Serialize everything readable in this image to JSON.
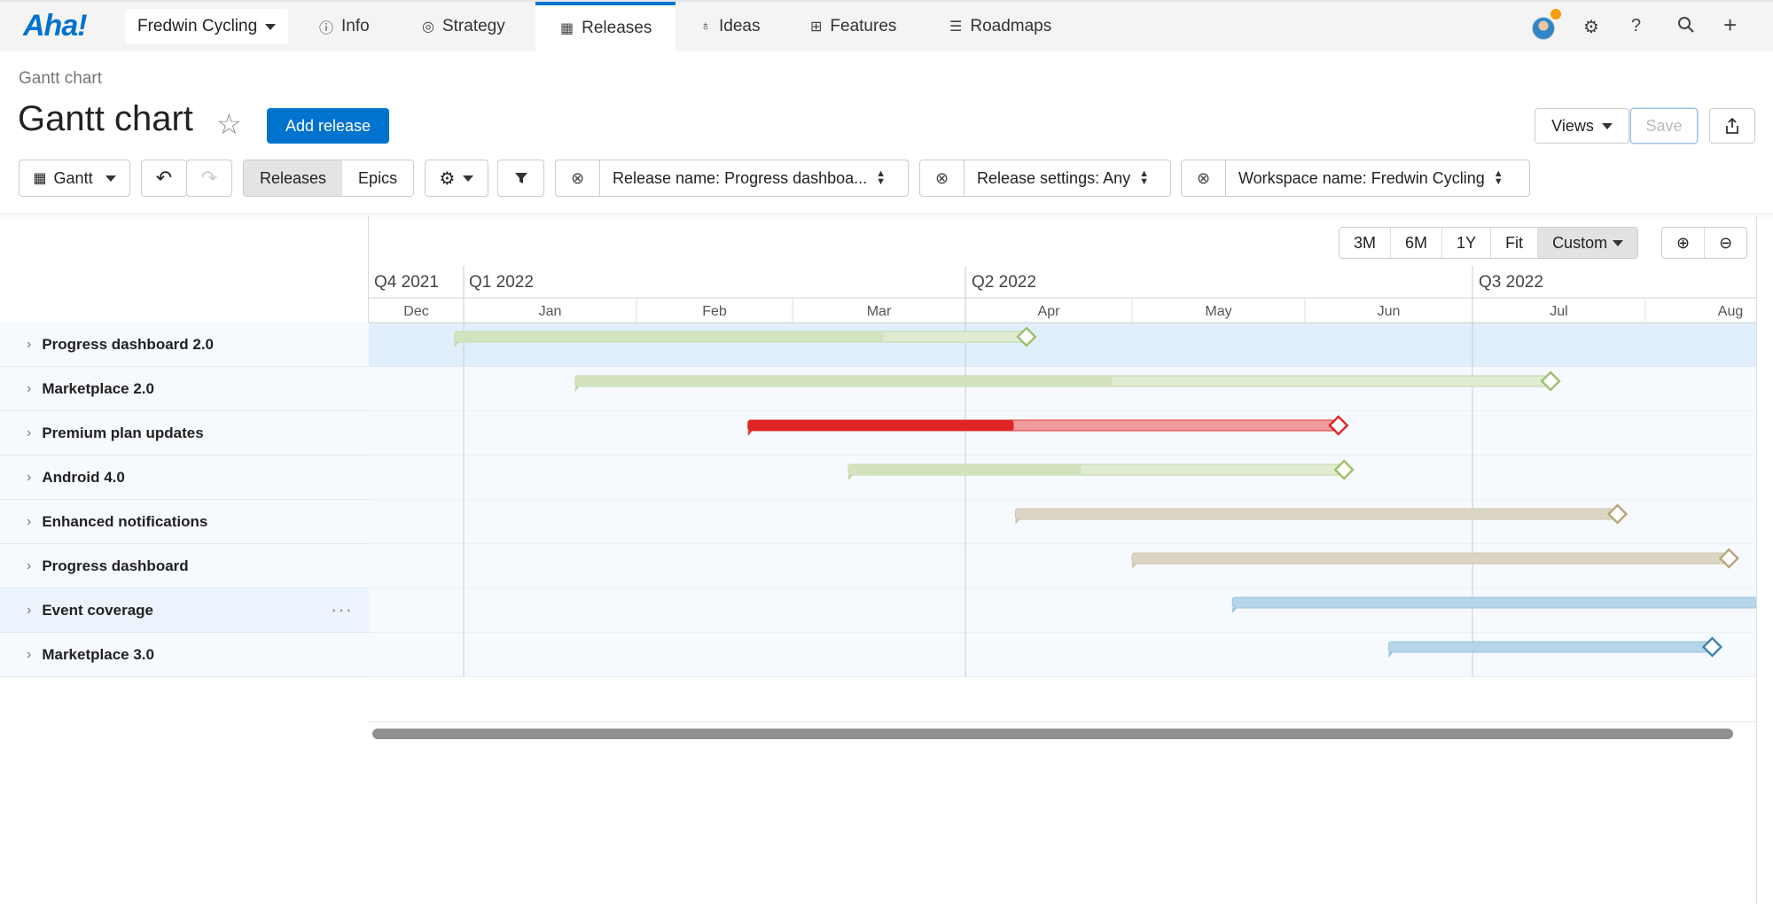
{
  "nav": {
    "logo": "Aha!",
    "workspace": "Fredwin Cycling",
    "tabs": [
      {
        "label": "Info",
        "icon": "info-icon"
      },
      {
        "label": "Strategy",
        "icon": "target-icon"
      },
      {
        "label": "Releases",
        "icon": "calendar-icon"
      },
      {
        "label": "Ideas",
        "icon": "lightbulb-icon"
      },
      {
        "label": "Features",
        "icon": "grid-icon"
      },
      {
        "label": "Roadmaps",
        "icon": "roadmap-icon"
      }
    ],
    "active_tab": "Releases"
  },
  "header": {
    "breadcrumb": "Gantt chart",
    "title": "Gantt chart",
    "add_release": "Add release",
    "views": "Views",
    "save": "Save"
  },
  "toolbar": {
    "view_mode": "Gantt",
    "segments": [
      "Releases",
      "Epics"
    ],
    "active_segment": "Releases",
    "filters": [
      "Release name: Progress dashboa...",
      "Release settings: Any",
      "Workspace name: Fredwin Cycling"
    ]
  },
  "timeline": {
    "zoom_options": [
      "3M",
      "6M",
      "1Y",
      "Fit",
      "Custom"
    ],
    "active_zoom": "Custom",
    "quarters": [
      "Q4 2021",
      "Q1 2022",
      "Q2 2022",
      "Q3 2022"
    ],
    "months": [
      "Dec",
      "Jan",
      "Feb",
      "Mar",
      "Apr",
      "May",
      "Jun",
      "Jul",
      "Aug"
    ]
  },
  "releases": [
    {
      "name": "Progress dashboard 2.0",
      "start": "2021-12-29",
      "end": "2022-04-12",
      "progress": 0.75,
      "color": "#b9d49a"
    },
    {
      "name": "Marketplace 2.0",
      "start": "2022-01-21",
      "end": "2022-07-15",
      "progress": 0.55,
      "color": "#b9d49a"
    },
    {
      "name": "Premium plan updates",
      "start": "2022-02-21",
      "end": "2022-06-07",
      "progress": 0.45,
      "color": "#e02424"
    },
    {
      "name": "Android 4.0",
      "start": "2022-03-11",
      "end": "2022-06-08",
      "progress": 0.47,
      "color": "#b9d49a"
    },
    {
      "name": "Enhanced notifications",
      "start": "2022-04-10",
      "end": "2022-07-27",
      "progress": 0.0,
      "color": "#c8bfa3"
    },
    {
      "name": "Progress dashboard",
      "start": "2022-05-01",
      "end": "2022-08-16",
      "progress": 0.0,
      "color": "#c8bfa3"
    },
    {
      "name": "Event coverage",
      "start": "2022-05-19",
      "end": "2022-08-31",
      "progress": 0.0,
      "color": "#8fbfdc"
    },
    {
      "name": "Marketplace 3.0",
      "start": "2022-06-16",
      "end": "2022-08-13",
      "progress": 0.0,
      "color": "#8fbfdc"
    }
  ]
}
